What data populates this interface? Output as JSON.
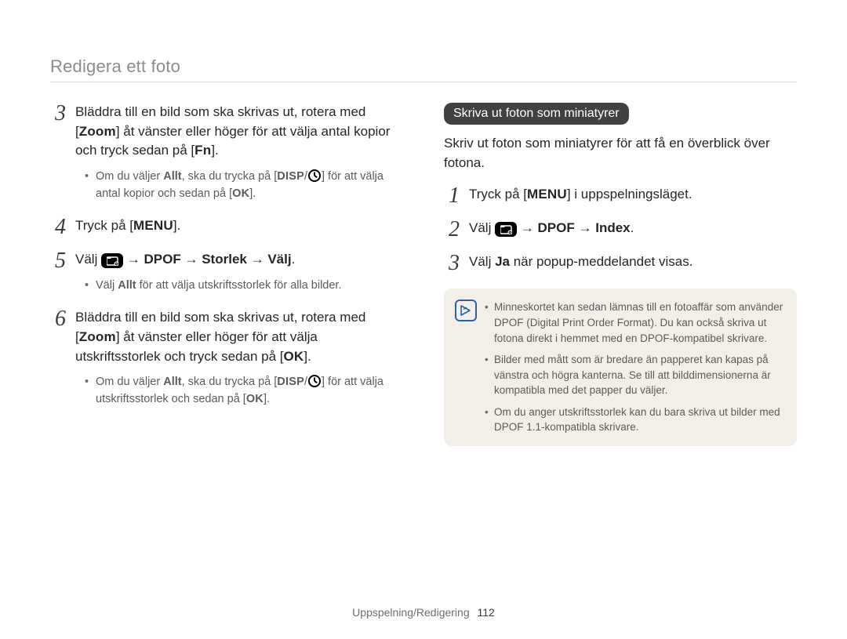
{
  "page_title": "Redigera ett foto",
  "footer": {
    "section": "Uppspelning/Redigering",
    "page_number": "112"
  },
  "left": {
    "step3": {
      "num": "3",
      "line1a": "Bläddra till en bild som ska skrivas ut, rotera med [",
      "zoom": "Zoom",
      "line1b": "] åt vänster eller höger för att välja antal kopior och tryck sedan på [",
      "fn": "Fn",
      "line1c": "].",
      "sub_a": "Om du väljer ",
      "sub_allt": "Allt",
      "sub_b": ", ska du trycka på [",
      "disp": "DISP",
      "sub_c": "/",
      "sub_d": "] för att välja antal kopior och sedan på [",
      "ok": "OK",
      "sub_e": "]."
    },
    "step4": {
      "num": "4",
      "a": "Tryck på [",
      "menu": "MENU",
      "b": "]."
    },
    "step5": {
      "num": "5",
      "a": "Välj ",
      "arrow1": " → ",
      "dpof": "DPOF",
      "arrow2": " → ",
      "storlek": "Storlek",
      "arrow3": " → ",
      "valj": "Välj",
      "dot": ".",
      "sub_a": "Välj ",
      "sub_allt": "Allt",
      "sub_b": " för att välja utskriftsstorlek för alla bilder."
    },
    "step6": {
      "num": "6",
      "line1a": "Bläddra till en bild som ska skrivas ut, rotera med [",
      "zoom": "Zoom",
      "line1b": "] åt vänster eller höger för att välja utskriftsstorlek och tryck sedan på [",
      "ok": "OK",
      "line1c": "].",
      "sub_a": "Om du väljer ",
      "sub_allt": "Allt",
      "sub_b": ", ska du trycka på [",
      "disp": "DISP",
      "sub_c": "/",
      "sub_d": "] för att välja utskriftsstorlek och sedan på [",
      "ok2": "OK",
      "sub_e": "]."
    }
  },
  "right": {
    "heading": "Skriva ut foton som miniatyrer",
    "intro": "Skriv ut foton som miniatyrer för att få en överblick över fotona.",
    "step1": {
      "num": "1",
      "a": "Tryck på [",
      "menu": "MENU",
      "b": "] i uppspelningsläget."
    },
    "step2": {
      "num": "2",
      "a": "Välj ",
      "arrow1": " → ",
      "dpof": "DPOF",
      "arrow2": " → ",
      "index": "Index",
      "dot": "."
    },
    "step3": {
      "num": "3",
      "a": "Välj ",
      "ja": "Ja",
      "b": " när popup-meddelandet visas."
    },
    "notes": {
      "n1": "Minneskortet kan sedan lämnas till en fotoaffär som använder DPOF (Digital Print Order Format). Du kan också skriva ut fotona direkt i hemmet med en DPOF-kompatibel skrivare.",
      "n2": "Bilder med mått som är bredare än papperet kan kapas på vänstra och högra kanterna. Se till att bilddimensionerna är kompatibla med det papper du väljer.",
      "n3": "Om du anger utskriftsstorlek kan du bara skriva ut bilder med DPOF 1.1-kompatibla skrivare."
    }
  }
}
